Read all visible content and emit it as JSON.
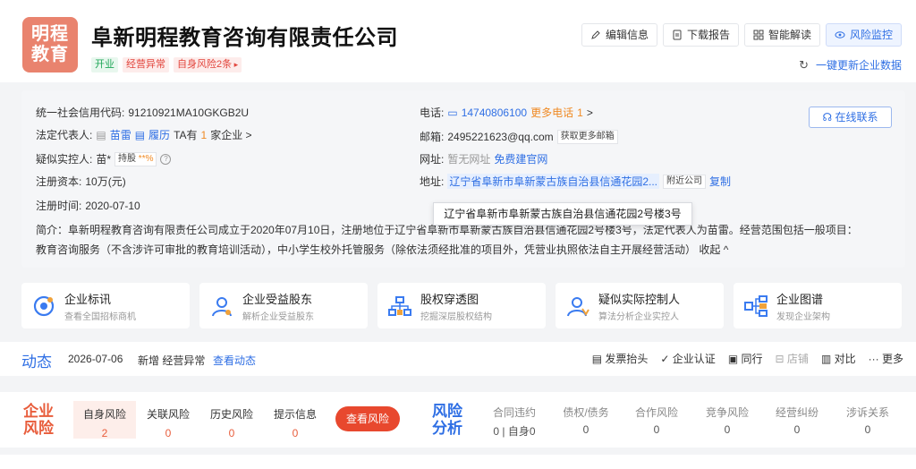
{
  "company": {
    "logo_text": "明程\n教育",
    "logo_line1": "明程",
    "logo_line2": "教育",
    "name": "阜新明程教育咨询有限责任公司",
    "tags": [
      "开业",
      "经营异常",
      "自身风险2条"
    ],
    "accent_color": "#2f6fe4",
    "logo_color": "#e9836e"
  },
  "actions": {
    "edit": "编辑信息",
    "download": "下载报告",
    "ai": "智能解读",
    "monitor": "风险监控",
    "refresh": "一键更新企业数据"
  },
  "info": {
    "credit_code_label": "统一社会信用代码:",
    "credit_code": "91210921MA10GKGB2U",
    "legal_rep_label": "法定代表人:",
    "legal_rep": "苗雷",
    "resume": "履历",
    "ta_has": "TA有",
    "ta_count": "1",
    "ta_suffix": "家企业 >",
    "controller_label": "疑似实控人:",
    "controller": "苗*",
    "holding": "持股",
    "holding_pct": "**%",
    "capital_label": "注册资本:",
    "capital": "10万(元)",
    "reg_time_label": "注册时间:",
    "reg_time": "2020-07-10",
    "phone_label": "电话:",
    "phone": "14740806100",
    "more_phones": "更多电话",
    "more_phones_count": "1",
    "email_label": "邮箱:",
    "email": "2495221623@qq.com",
    "more_email": "获取更多邮箱",
    "website_label": "网址:",
    "website": "暂无网址",
    "build_site": "免费建官网",
    "address_label": "地址:",
    "address": "辽宁省阜新市阜新蒙古族自治县信通花园2...",
    "nearby": "附近公司",
    "copy": "复制",
    "contact_online": "在线联系",
    "tooltip": "辽宁省阜新市阜新蒙古族自治县信通花园2号楼3号",
    "intro_line1": "简介：阜新明程教育咨询有限责任公司成立于2020年07月10日，注册地位于辽宁省阜新市阜新蒙古族自治县信通花园2号楼3号，法定代表人为苗雷。经营范围包括一般项目：",
    "intro_line2": "教育咨询服务（不含涉许可审批的教育培训活动），中小学生校外托管服务（除依法须经批准的项目外，凭营业执照依法自主开展经营活动）",
    "collapse": "收起 ^"
  },
  "features": [
    {
      "title": "企业标讯",
      "sub": "查看全国招标商机",
      "icon": "bid-icon"
    },
    {
      "title": "企业受益股东",
      "sub": "解析企业受益股东",
      "icon": "person-icon"
    },
    {
      "title": "股权穿透图",
      "sub": "挖掘深层股权结构",
      "icon": "equity-icon"
    },
    {
      "title": "疑似实际控制人",
      "sub": "算法分析企业实控人",
      "icon": "controller-icon"
    },
    {
      "title": "企业图谱",
      "sub": "发现企业架构",
      "icon": "graph-icon"
    }
  ],
  "dynamics": {
    "heading": "动态",
    "date": "2026-07-06",
    "news": "新增 经营异常",
    "view": "查看动态",
    "links": [
      "发票抬头",
      "企业认证",
      "同行",
      "店铺",
      "对比",
      "更多"
    ]
  },
  "risk": {
    "heading_line1": "企业",
    "heading_line2": "风险",
    "cells": [
      {
        "label": "自身风险",
        "value": "2"
      },
      {
        "label": "关联风险",
        "value": "0"
      },
      {
        "label": "历史风险",
        "value": "0"
      },
      {
        "label": "提示信息",
        "value": "0"
      }
    ],
    "check_button": "查看风险",
    "analysis_line1": "风险",
    "analysis_line2": "分析",
    "analysis_cells": [
      {
        "label": "合同违约",
        "value": "0 | 自身0"
      },
      {
        "label": "债权/债务",
        "value": "0"
      },
      {
        "label": "合作风险",
        "value": "0"
      },
      {
        "label": "竞争风险",
        "value": "0"
      },
      {
        "label": "经营纠纷",
        "value": "0"
      },
      {
        "label": "涉诉关系",
        "value": "0"
      }
    ]
  }
}
